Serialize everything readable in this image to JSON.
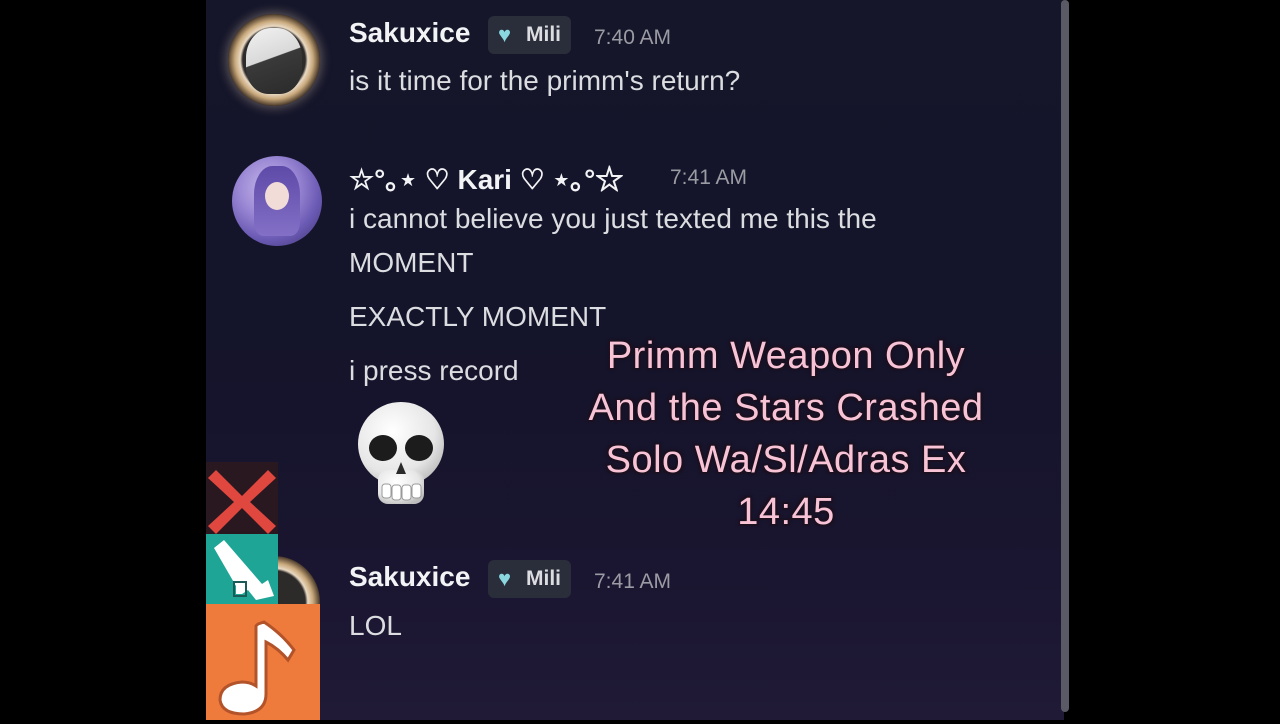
{
  "messages": [
    {
      "username": "Sakuxice",
      "tag": "Mili",
      "time": "7:40 AM",
      "lines": [
        "is it time for the primm's return?"
      ]
    },
    {
      "username": "☆°｡⋆ ♡ Kari ♡ ⋆｡°☆",
      "time": "7:41 AM",
      "lines": [
        "i cannot believe you just texted me this the",
        "MOMENT",
        "EXACTLY MOMENT",
        "i press record"
      ],
      "emoji": "skull-emoji"
    },
    {
      "username": "Sakuxice",
      "tag": "Mili",
      "time": "7:41 AM",
      "lines": [
        "LOL"
      ]
    }
  ],
  "overlay": {
    "lines": [
      "Primm Weapon Only",
      "And the Stars Crashed",
      "Solo Wa/Sl/Adras Ex",
      "14:45"
    ]
  },
  "colors": {
    "background": "#14142a",
    "overlay_text": "#f9c3d6",
    "tag_heart": "#8ad7df",
    "deco_red": "#e0483f",
    "deco_teal": "#1fa596",
    "deco_orange": "#ee7a3c"
  },
  "icons": [
    "heart-badge-icon",
    "close-x-icon",
    "tap-hand-icon",
    "music-note-icon",
    "skull-emoji"
  ]
}
